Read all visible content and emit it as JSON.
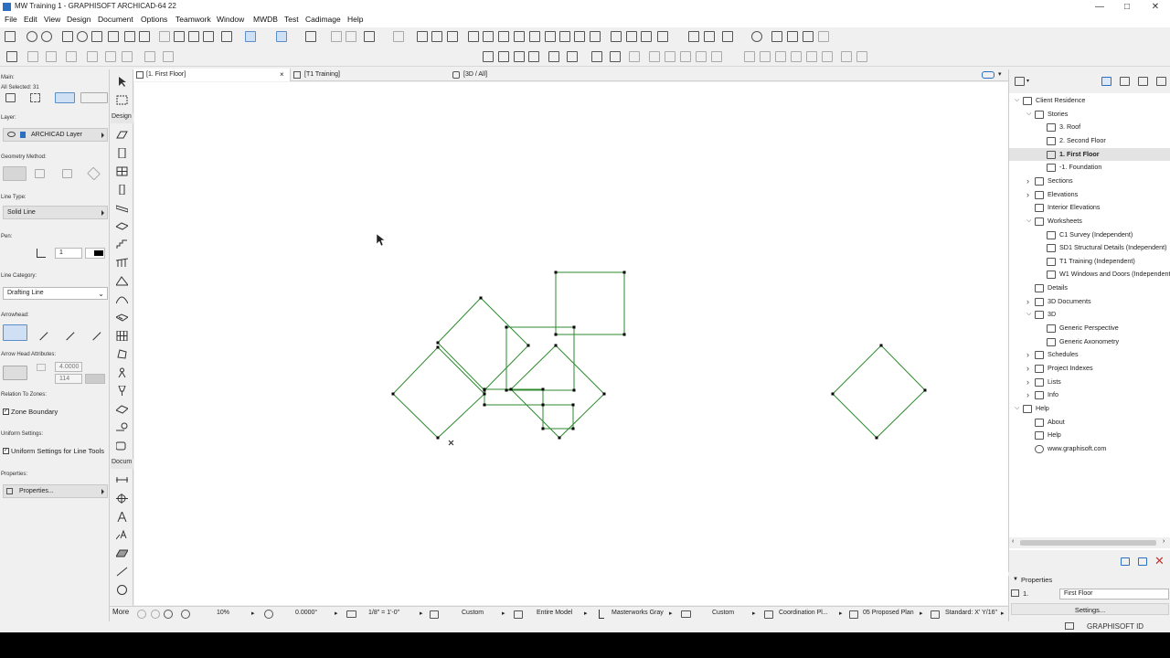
{
  "window": {
    "title": "MW Training 1 - GRAPHISOFT ARCHICAD-64 22"
  },
  "menu": [
    "File",
    "Edit",
    "View",
    "Design",
    "Document",
    "Options",
    "Teamwork",
    "Window",
    "MWDB",
    "Test",
    "Cadimage",
    "Help"
  ],
  "infobox": {
    "main_label": "Main:",
    "selected": "All Selected: 31",
    "layer_label": "Layer:",
    "layer_value": "ARCHICAD Layer",
    "geometry_label": "Geometry Method:",
    "line_type_label": "Line Type:",
    "line_type_value": "Solid Line",
    "pen_label": "Pen:",
    "pen_value": "1",
    "line_category_label": "Line Category:",
    "line_category_value": "Drafting Line",
    "arrowhead_label": "Arrowhead:",
    "arrow_attr_label": "Arrow Head Attributes:",
    "arrow_size": "4.0000",
    "arrow_pen": "114",
    "relation_label": "Relation To Zones:",
    "zone_boundary": "Zone Boundary",
    "uniform_label": "Uniform Settings:",
    "uniform_value": "Uniform Settings for Line Tools",
    "properties_label": "Properties:",
    "properties_button": "Properties..."
  },
  "toolbox": {
    "design_label": "Design",
    "document_label": "Docum",
    "more_label": "More"
  },
  "tabs": [
    {
      "label": "[1. First Floor]",
      "active": true
    },
    {
      "label": "[T1 Training]",
      "active": false
    },
    {
      "label": "[3D / All]",
      "active": false
    }
  ],
  "status": {
    "zoom": "10%",
    "angle": "0.0000°",
    "scale": "1/8\"   =   1'-0\"",
    "layer_combo": "Custom",
    "model_view": "Entire Model",
    "pen_set": "Masterworks Gray",
    "dimension": "Custom",
    "renovation": "Coordination Pl...",
    "plan": "05 Proposed Plan",
    "dim_standard": "Standard: X' Y/16\""
  },
  "navigator": {
    "items": [
      {
        "label": "Client Residence",
        "level": 0,
        "expanded": true,
        "icon": "project-icon"
      },
      {
        "label": "Stories",
        "level": 1,
        "expanded": true,
        "icon": "stories-icon"
      },
      {
        "label": "3. Roof",
        "level": 2,
        "icon": "story-icon"
      },
      {
        "label": "2. Second Floor",
        "level": 2,
        "icon": "story-icon"
      },
      {
        "label": "1. First Floor",
        "level": 2,
        "icon": "story-icon",
        "selected": true
      },
      {
        "label": "-1. Foundation",
        "level": 2,
        "icon": "story-icon"
      },
      {
        "label": "Sections",
        "level": 1,
        "expanded": false,
        "icon": "section-icon"
      },
      {
        "label": "Elevations",
        "level": 1,
        "expanded": false,
        "icon": "elevation-icon"
      },
      {
        "label": "Interior Elevations",
        "level": 1,
        "icon": "interior-elevation-icon"
      },
      {
        "label": "Worksheets",
        "level": 1,
        "expanded": true,
        "icon": "worksheet-icon"
      },
      {
        "label": "C1 Survey (Independent)",
        "level": 2,
        "icon": "worksheet-icon"
      },
      {
        "label": "SD1 Structural Details (Independent)",
        "level": 2,
        "icon": "worksheet-icon"
      },
      {
        "label": "T1 Training (Independent)",
        "level": 2,
        "icon": "worksheet-icon"
      },
      {
        "label": "W1 Windows and Doors (Independent)",
        "level": 2,
        "icon": "worksheet-icon"
      },
      {
        "label": "Details",
        "level": 1,
        "icon": "detail-icon"
      },
      {
        "label": "3D Documents",
        "level": 1,
        "expanded": false,
        "icon": "3d-document-icon"
      },
      {
        "label": "3D",
        "level": 1,
        "expanded": true,
        "icon": "3d-icon"
      },
      {
        "label": "Generic Perspective",
        "level": 2,
        "icon": "perspective-icon"
      },
      {
        "label": "Generic Axonometry",
        "level": 2,
        "icon": "axonometry-icon"
      },
      {
        "label": "Schedules",
        "level": 1,
        "expanded": false,
        "icon": "schedule-icon"
      },
      {
        "label": "Project Indexes",
        "level": 1,
        "expanded": false,
        "icon": "index-icon"
      },
      {
        "label": "Lists",
        "level": 1,
        "expanded": false,
        "icon": "list-icon"
      },
      {
        "label": "Info",
        "level": 1,
        "expanded": false,
        "icon": "info-icon"
      },
      {
        "label": "Help",
        "level": 0,
        "expanded": true,
        "icon": "help-icon"
      },
      {
        "label": "About",
        "level": 1,
        "icon": "about-icon"
      },
      {
        "label": "Help",
        "level": 1,
        "icon": "help-icon"
      },
      {
        "label": "www.graphisoft.com",
        "level": 1,
        "icon": "web-icon"
      }
    ]
  },
  "properties": {
    "header": "Properties",
    "story_num": "1.",
    "story_name": "First Floor",
    "settings_button": "Settings..."
  },
  "footer": {
    "brand": "GRAPHISOFT ID"
  },
  "colors": {
    "drawing_line": "#2f8a2f",
    "node": "#000000",
    "accent": "#2a6fc0"
  }
}
